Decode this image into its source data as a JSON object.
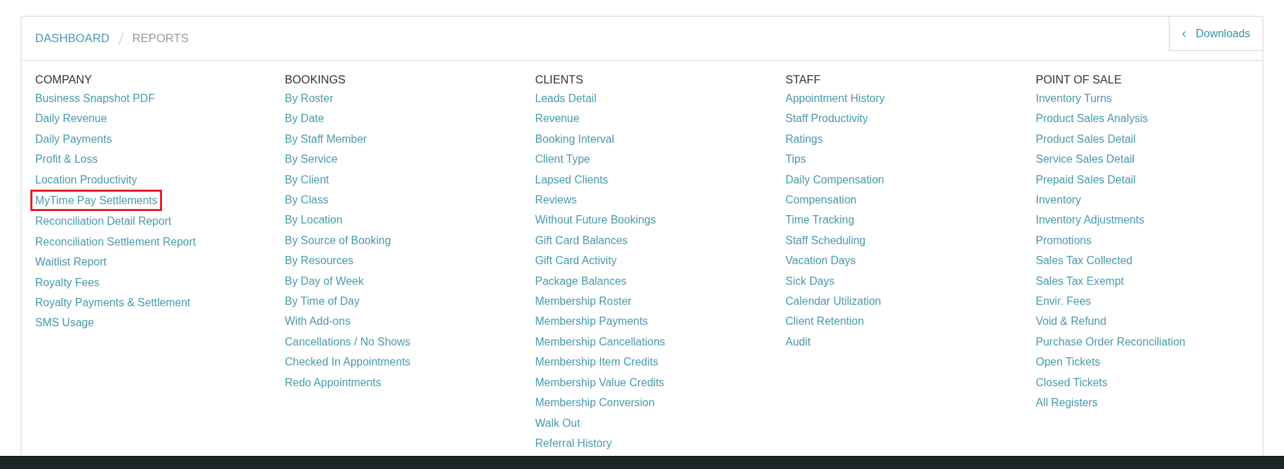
{
  "breadcrumb": [
    {
      "label": "DASHBOARD",
      "kind": "link"
    },
    {
      "label": "REPORTS",
      "kind": "current"
    }
  ],
  "downloads": {
    "label": "Downloads",
    "icon": "‹"
  },
  "columns": [
    {
      "heading": "COMPANY",
      "items": [
        {
          "label": "Business Snapshot PDF",
          "highlighted": false
        },
        {
          "label": "Daily Revenue",
          "highlighted": false
        },
        {
          "label": "Daily Payments",
          "highlighted": false
        },
        {
          "label": "Profit & Loss",
          "highlighted": false
        },
        {
          "label": "Location Productivity",
          "highlighted": false
        },
        {
          "label": "MyTime Pay Settlements",
          "highlighted": true
        },
        {
          "label": "Reconciliation Detail Report",
          "highlighted": false
        },
        {
          "label": "Reconciliation Settlement Report",
          "highlighted": false
        },
        {
          "label": "Waitlist Report",
          "highlighted": false
        },
        {
          "label": "Royalty Fees",
          "highlighted": false
        },
        {
          "label": "Royalty Payments & Settlement",
          "highlighted": false
        },
        {
          "label": "SMS Usage",
          "highlighted": false
        }
      ]
    },
    {
      "heading": "BOOKINGS",
      "items": [
        {
          "label": "By Roster",
          "highlighted": false
        },
        {
          "label": "By Date",
          "highlighted": false
        },
        {
          "label": "By Staff Member",
          "highlighted": false
        },
        {
          "label": "By Service",
          "highlighted": false
        },
        {
          "label": "By Client",
          "highlighted": false
        },
        {
          "label": "By Class",
          "highlighted": false
        },
        {
          "label": "By Location",
          "highlighted": false
        },
        {
          "label": "By Source of Booking",
          "highlighted": false
        },
        {
          "label": "By Resources",
          "highlighted": false
        },
        {
          "label": "By Day of Week",
          "highlighted": false
        },
        {
          "label": "By Time of Day",
          "highlighted": false
        },
        {
          "label": "With Add-ons",
          "highlighted": false
        },
        {
          "label": "Cancellations / No Shows",
          "highlighted": false
        },
        {
          "label": "Checked In Appointments",
          "highlighted": false
        },
        {
          "label": "Redo Appointments",
          "highlighted": false
        }
      ]
    },
    {
      "heading": "CLIENTS",
      "items": [
        {
          "label": "Leads Detail",
          "highlighted": false
        },
        {
          "label": "Revenue",
          "highlighted": false
        },
        {
          "label": "Booking Interval",
          "highlighted": false
        },
        {
          "label": "Client Type",
          "highlighted": false
        },
        {
          "label": "Lapsed Clients",
          "highlighted": false
        },
        {
          "label": "Reviews",
          "highlighted": false
        },
        {
          "label": "Without Future Bookings",
          "highlighted": false
        },
        {
          "label": "Gift Card Balances",
          "highlighted": false
        },
        {
          "label": "Gift Card Activity",
          "highlighted": false
        },
        {
          "label": "Package Balances",
          "highlighted": false
        },
        {
          "label": "Membership Roster",
          "highlighted": false
        },
        {
          "label": "Membership Payments",
          "highlighted": false
        },
        {
          "label": "Membership Cancellations",
          "highlighted": false
        },
        {
          "label": "Membership Item Credits",
          "highlighted": false
        },
        {
          "label": "Membership Value Credits",
          "highlighted": false
        },
        {
          "label": "Membership Conversion",
          "highlighted": false
        },
        {
          "label": "Walk Out",
          "highlighted": false
        },
        {
          "label": "Referral History",
          "highlighted": false
        }
      ]
    },
    {
      "heading": "STAFF",
      "items": [
        {
          "label": "Appointment History",
          "highlighted": false
        },
        {
          "label": "Staff Productivity",
          "highlighted": false
        },
        {
          "label": "Ratings",
          "highlighted": false
        },
        {
          "label": "Tips",
          "highlighted": false
        },
        {
          "label": "Daily Compensation",
          "highlighted": false
        },
        {
          "label": "Compensation",
          "highlighted": false
        },
        {
          "label": "Time Tracking",
          "highlighted": false
        },
        {
          "label": "Staff Scheduling",
          "highlighted": false
        },
        {
          "label": "Vacation Days",
          "highlighted": false
        },
        {
          "label": "Sick Days",
          "highlighted": false
        },
        {
          "label": "Calendar Utilization",
          "highlighted": false
        },
        {
          "label": "Client Retention",
          "highlighted": false
        },
        {
          "label": "Audit",
          "highlighted": false
        }
      ]
    },
    {
      "heading": "POINT OF SALE",
      "items": [
        {
          "label": "Inventory Turns",
          "highlighted": false
        },
        {
          "label": "Product Sales Analysis",
          "highlighted": false
        },
        {
          "label": "Product Sales Detail",
          "highlighted": false
        },
        {
          "label": "Service Sales Detail",
          "highlighted": false
        },
        {
          "label": "Prepaid Sales Detail",
          "highlighted": false
        },
        {
          "label": "Inventory",
          "highlighted": false
        },
        {
          "label": "Inventory Adjustments",
          "highlighted": false
        },
        {
          "label": "Promotions",
          "highlighted": false
        },
        {
          "label": "Sales Tax Collected",
          "highlighted": false
        },
        {
          "label": "Sales Tax Exempt",
          "highlighted": false
        },
        {
          "label": "Envir. Fees",
          "highlighted": false
        },
        {
          "label": "Void & Refund",
          "highlighted": false
        },
        {
          "label": "Purchase Order Reconciliation",
          "highlighted": false
        },
        {
          "label": "Open Tickets",
          "highlighted": false
        },
        {
          "label": "Closed Tickets",
          "highlighted": false
        },
        {
          "label": "All Registers",
          "highlighted": false
        }
      ]
    }
  ]
}
